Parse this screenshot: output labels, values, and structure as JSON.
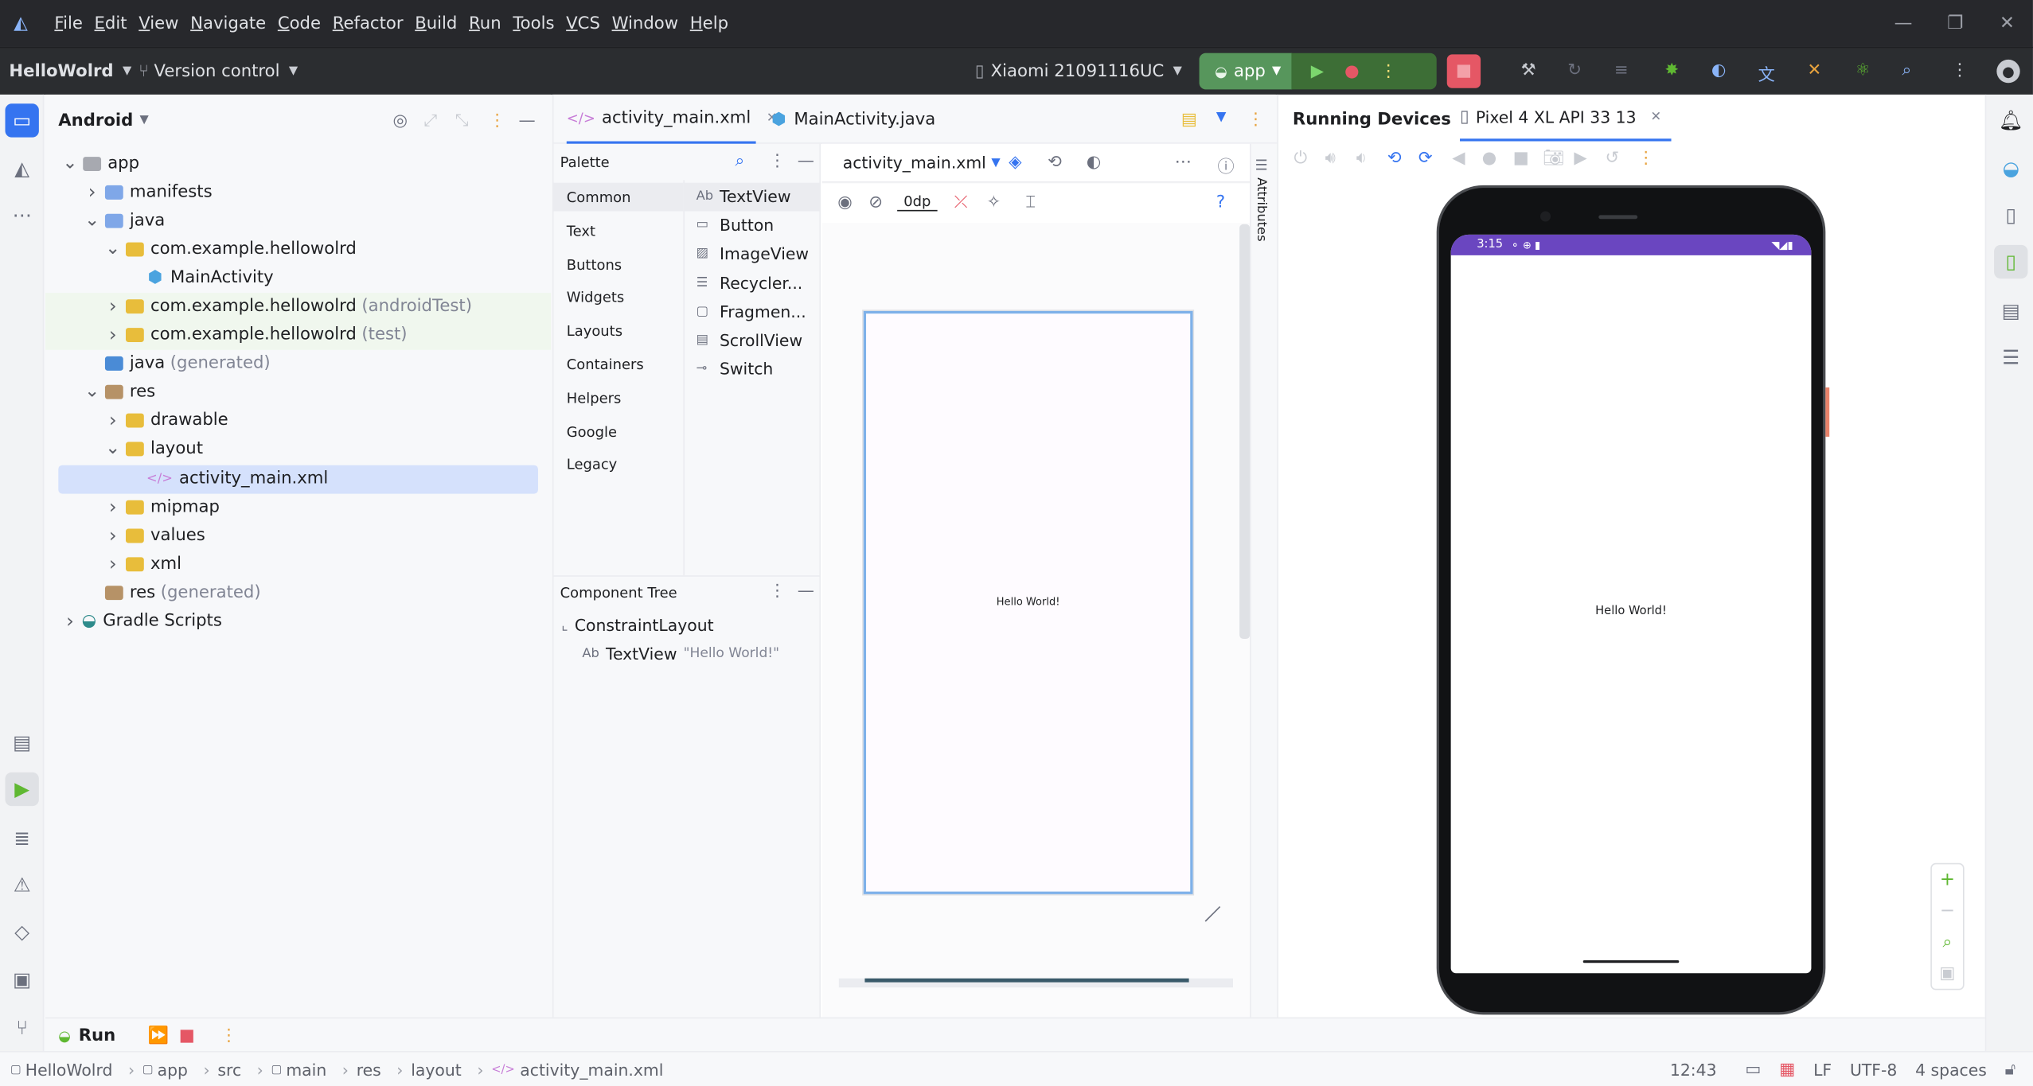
{
  "menu": [
    "File",
    "Edit",
    "View",
    "Navigate",
    "Code",
    "Refactor",
    "Build",
    "Run",
    "Tools",
    "VCS",
    "Window",
    "Help"
  ],
  "toolbar": {
    "project_name": "HelloWolrd",
    "version_control": "Version control",
    "device": "Xiaomi 21091116UC",
    "run_config": "app"
  },
  "project_panel": {
    "view_selector": "Android",
    "tree": [
      {
        "label": "app",
        "depth": 0,
        "chev": "v",
        "icon": "module"
      },
      {
        "label": "manifests",
        "depth": 1,
        "chev": ">",
        "icon": "folder-blue"
      },
      {
        "label": "java",
        "depth": 1,
        "chev": "v",
        "icon": "folder-blue"
      },
      {
        "label": "com.example.hellowolrd",
        "depth": 2,
        "chev": "v",
        "icon": "folder-yellow"
      },
      {
        "label": "MainActivity",
        "depth": 3,
        "chev": "",
        "icon": "class"
      },
      {
        "label": "com.example.hellowolrd",
        "suffix": "(androidTest)",
        "depth": 2,
        "chev": ">",
        "icon": "folder-yellow"
      },
      {
        "label": "com.example.hellowolrd",
        "suffix": "(test)",
        "depth": 2,
        "chev": ">",
        "icon": "folder-yellow"
      },
      {
        "label": "java",
        "suffix": "(generated)",
        "depth": 1,
        "chev": "",
        "icon": "folder-gen"
      },
      {
        "label": "res",
        "depth": 1,
        "chev": "v",
        "icon": "folder-brown"
      },
      {
        "label": "drawable",
        "depth": 2,
        "chev": ">",
        "icon": "folder-yellow"
      },
      {
        "label": "layout",
        "depth": 2,
        "chev": "v",
        "icon": "folder-yellow"
      },
      {
        "label": "activity_main.xml",
        "depth": 3,
        "chev": "",
        "icon": "xml"
      },
      {
        "label": "mipmap",
        "depth": 2,
        "chev": ">",
        "icon": "folder-yellow"
      },
      {
        "label": "values",
        "depth": 2,
        "chev": ">",
        "icon": "folder-yellow"
      },
      {
        "label": "xml",
        "depth": 2,
        "chev": ">",
        "icon": "folder-yellow"
      },
      {
        "label": "res",
        "suffix": "(generated)",
        "depth": 1,
        "chev": "",
        "icon": "folder-brown"
      },
      {
        "label": "Gradle Scripts",
        "depth": 0,
        "chev": ">",
        "icon": "gradle"
      }
    ]
  },
  "editor": {
    "tabs": [
      "activity_main.xml",
      "MainActivity.java"
    ],
    "palette": {
      "title": "Palette",
      "categories": [
        "Common",
        "Text",
        "Buttons",
        "Widgets",
        "Layouts",
        "Containers",
        "Helpers",
        "Google",
        "Legacy"
      ],
      "items": [
        "TextView",
        "Button",
        "ImageView",
        "Recycler...",
        "Fragmen...",
        "ScrollView",
        "Switch"
      ]
    },
    "component_tree": {
      "title": "Component Tree",
      "root": "ConstraintLayout",
      "child": "TextView",
      "child_text": "\"Hello World!\""
    },
    "design": {
      "file_selector": "activity_main.xml",
      "margin": "0dp",
      "preview_text": "Hello World!",
      "attributes_label": "Attributes"
    }
  },
  "running_devices": {
    "title": "Running Devices",
    "device_tab": "Pixel 4 XL API 33 13",
    "status_time": "3:15",
    "screen_text": "Hello World!"
  },
  "run_panel": {
    "label": "Run"
  },
  "statusbar": {
    "breadcrumbs": [
      "HelloWolrd",
      "app",
      "src",
      "main",
      "res",
      "layout",
      "activity_main.xml"
    ],
    "time": "12:43",
    "line_ending": "LF",
    "encoding": "UTF-8",
    "indent": "4 spaces"
  },
  "colors": {
    "accent": "#3574f0",
    "selection": "#d5e1fc",
    "run_green": "#5fb832",
    "stop_red": "#e55765"
  }
}
